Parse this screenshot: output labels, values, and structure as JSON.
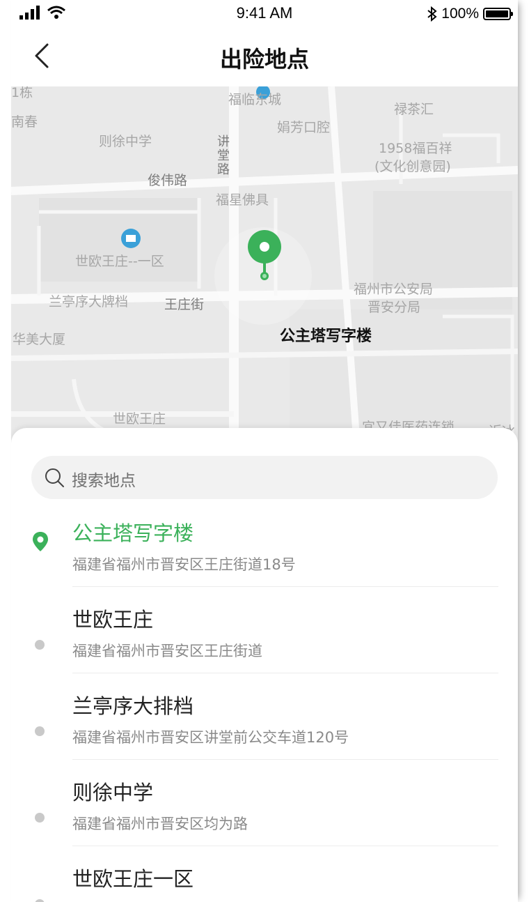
{
  "status_bar": {
    "time": "9:41 AM",
    "battery_percent": "100%",
    "icons": [
      "cellular-signal-icon",
      "wifi-icon",
      "bluetooth-icon",
      "battery-icon"
    ]
  },
  "nav": {
    "title": "出险地点",
    "back_icon": "chevron-left-icon"
  },
  "map": {
    "labels": {
      "building_top_left": "1栋",
      "nanchun": "南春",
      "fulin": "福临东城",
      "green_tea": "禄茶汇",
      "juanfang": "娟芳口腔",
      "zexu_school": "则徐中学",
      "jiangtang_road": "讲堂路",
      "baihuaxiang": "1958福百祥",
      "cultural_park": "(文化创意园)",
      "junwei_road": "俊伟路",
      "fuxing": "福星佛具",
      "shiou_1": "世欧王庄--一区",
      "police_1": "福州市公安局",
      "police_2": "晋安分局",
      "lanting": "兰亭序大牌档",
      "wangzhuang_st": "王庄街",
      "huamei": "华美大厦",
      "princess": "公主塔写字楼",
      "shiou": "世欧王庄",
      "pharmacy": "宜又佳医药连锁",
      "edge_right": "近冰"
    },
    "pin_color": "#3bb15a"
  },
  "search": {
    "placeholder": "搜索地点",
    "icon": "search-icon"
  },
  "places": [
    {
      "name": "公主塔写字楼",
      "address": "福建省福州市晋安区王庄街道18号",
      "selected": true
    },
    {
      "name": "世欧王庄",
      "address": "福建省福州市晋安区王庄街道",
      "selected": false
    },
    {
      "name": "兰亭序大排档",
      "address": "福建省福州市晋安区讲堂前公交车道120号",
      "selected": false
    },
    {
      "name": "则徐中学",
      "address": "福建省福州市晋安区均为路",
      "selected": false
    },
    {
      "name": "世欧王庄一区",
      "address": "",
      "selected": false
    }
  ],
  "colors": {
    "accent": "#3bb15a",
    "map_background": "#ececec"
  }
}
